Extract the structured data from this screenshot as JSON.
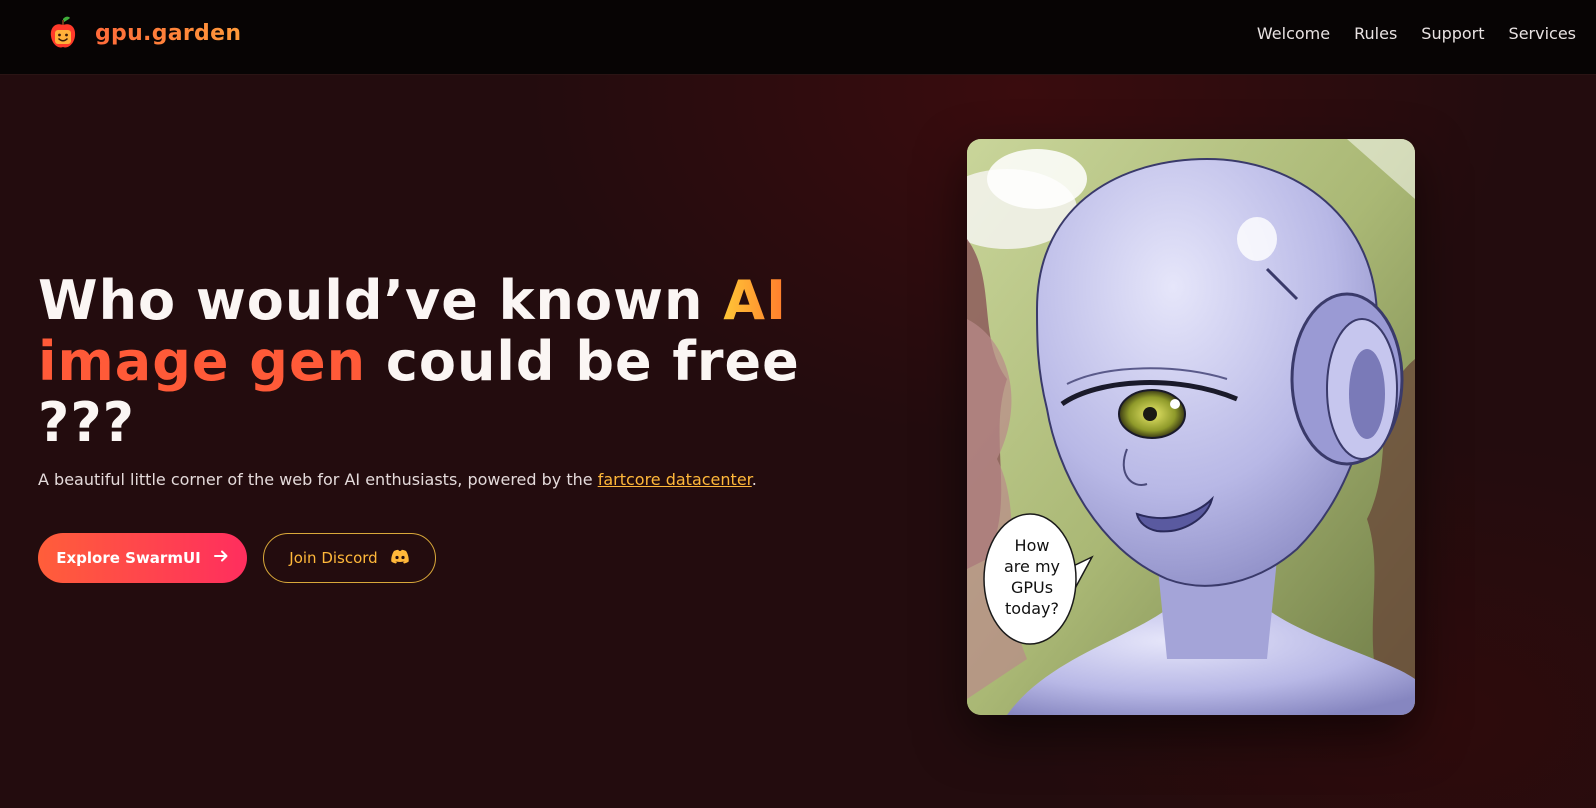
{
  "header": {
    "brand": "gpu.garden",
    "nav": [
      "Welcome",
      "Rules",
      "Support",
      "Services"
    ]
  },
  "hero": {
    "headline_part1": "Who would’ve known ",
    "headline_ai": "AI",
    "headline_gen": "image gen",
    "headline_part2": " could be free",
    "headline_part3": "???",
    "subtitle_prefix": "A beautiful little corner of the web for AI enthusiasts, powered by the ",
    "subtitle_link": "fartcore datacenter",
    "subtitle_suffix": ".",
    "primary_button": "Explore SwarmUI",
    "secondary_button": "Join Discord",
    "speech_bubble": "How\nare my\nGPUs\ntoday?"
  },
  "icons": {
    "logo": "apple-smile-icon",
    "primary_button_icon": "arrow-right-icon",
    "secondary_button_icon": "discord-icon"
  },
  "colors": {
    "accent_orange": "#ff5a38",
    "accent_gold": "#ffb83a",
    "background": "#230c0e",
    "header_bg": "#070404"
  }
}
